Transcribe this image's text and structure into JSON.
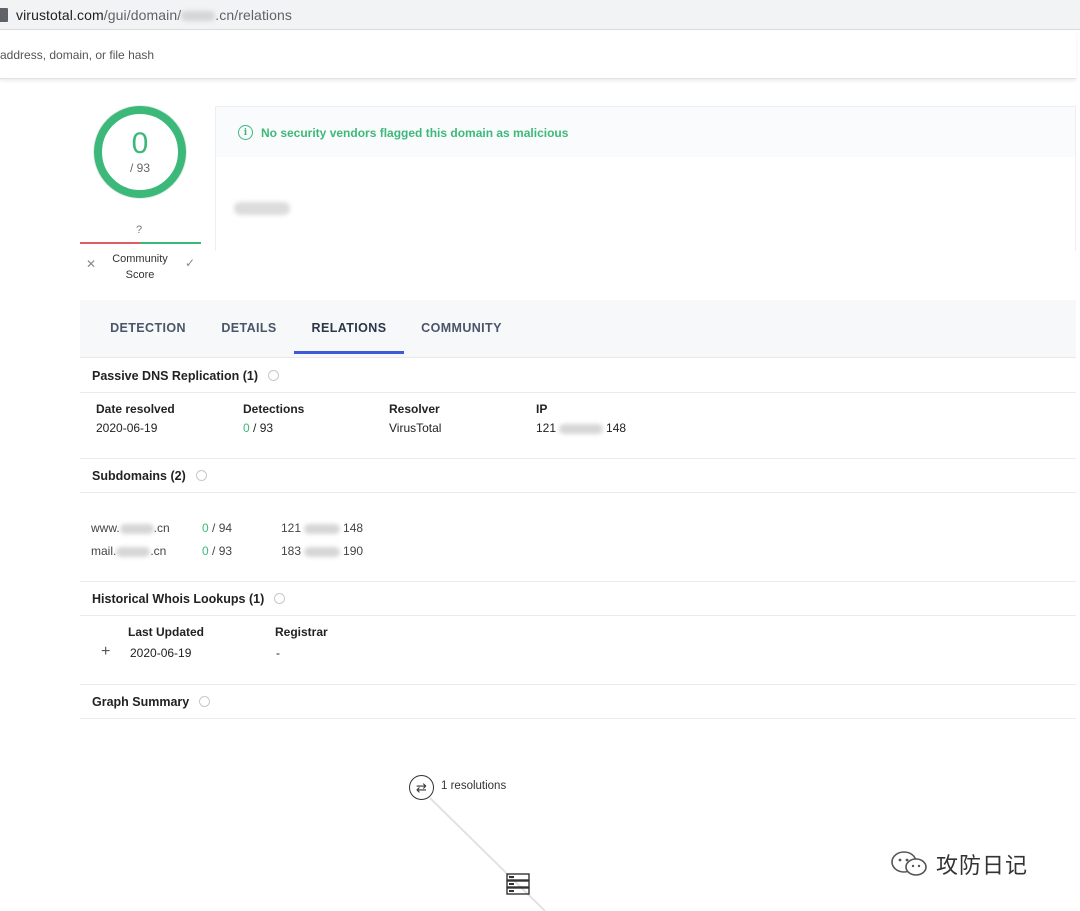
{
  "browser": {
    "url_host": "virustotal.com",
    "url_path_prefix": "/gui/domain/",
    "url_path_suffix": ".cn/relations"
  },
  "search": {
    "placeholder": "address, domain, or file hash"
  },
  "score": {
    "detections": "0",
    "total": "/ 93",
    "community_value": "?",
    "community_label_line1": "Community",
    "community_label_line2": "Score",
    "negative_icon": "✕",
    "positive_icon": "✓"
  },
  "verdict": {
    "message": "No security vendors flagged this domain as malicious"
  },
  "tabs": [
    {
      "label": "DETECTION"
    },
    {
      "label": "DETAILS"
    },
    {
      "label": "RELATIONS"
    },
    {
      "label": "COMMUNITY"
    }
  ],
  "active_tab": "RELATIONS",
  "passive_dns": {
    "title": "Passive DNS Replication (1)",
    "headers": [
      "Date resolved",
      "Detections",
      "Resolver",
      "IP"
    ],
    "rows": [
      {
        "date": "2020-06-19",
        "det_pos": "0",
        "det_total": " / 93",
        "resolver": "VirusTotal",
        "ip_start": "121",
        "ip_end": "148"
      }
    ]
  },
  "subdomains": {
    "title": "Subdomains (2)",
    "rows": [
      {
        "prefix": "www.",
        "suffix": ".cn",
        "det_pos": "0",
        "det_total": " / 94",
        "ip_start": "121",
        "ip_end": "148"
      },
      {
        "prefix": "mail.",
        "suffix": ".cn",
        "det_pos": "0",
        "det_total": " / 93",
        "ip_start": "183",
        "ip_end": "190"
      }
    ]
  },
  "whois": {
    "title": "Historical Whois Lookups (1)",
    "headers": [
      "Last Updated",
      "Registrar"
    ],
    "expand_icon": "+",
    "rows": [
      {
        "updated": "2020-06-19",
        "registrar": "-"
      }
    ]
  },
  "graph": {
    "title": "Graph Summary",
    "node_label": "1 resolutions"
  },
  "watermark": {
    "text": "攻防日记"
  },
  "colors": {
    "accent_green": "#3cb97a",
    "tab_active": "#3c5ad9",
    "negative_red": "#e05b66"
  }
}
